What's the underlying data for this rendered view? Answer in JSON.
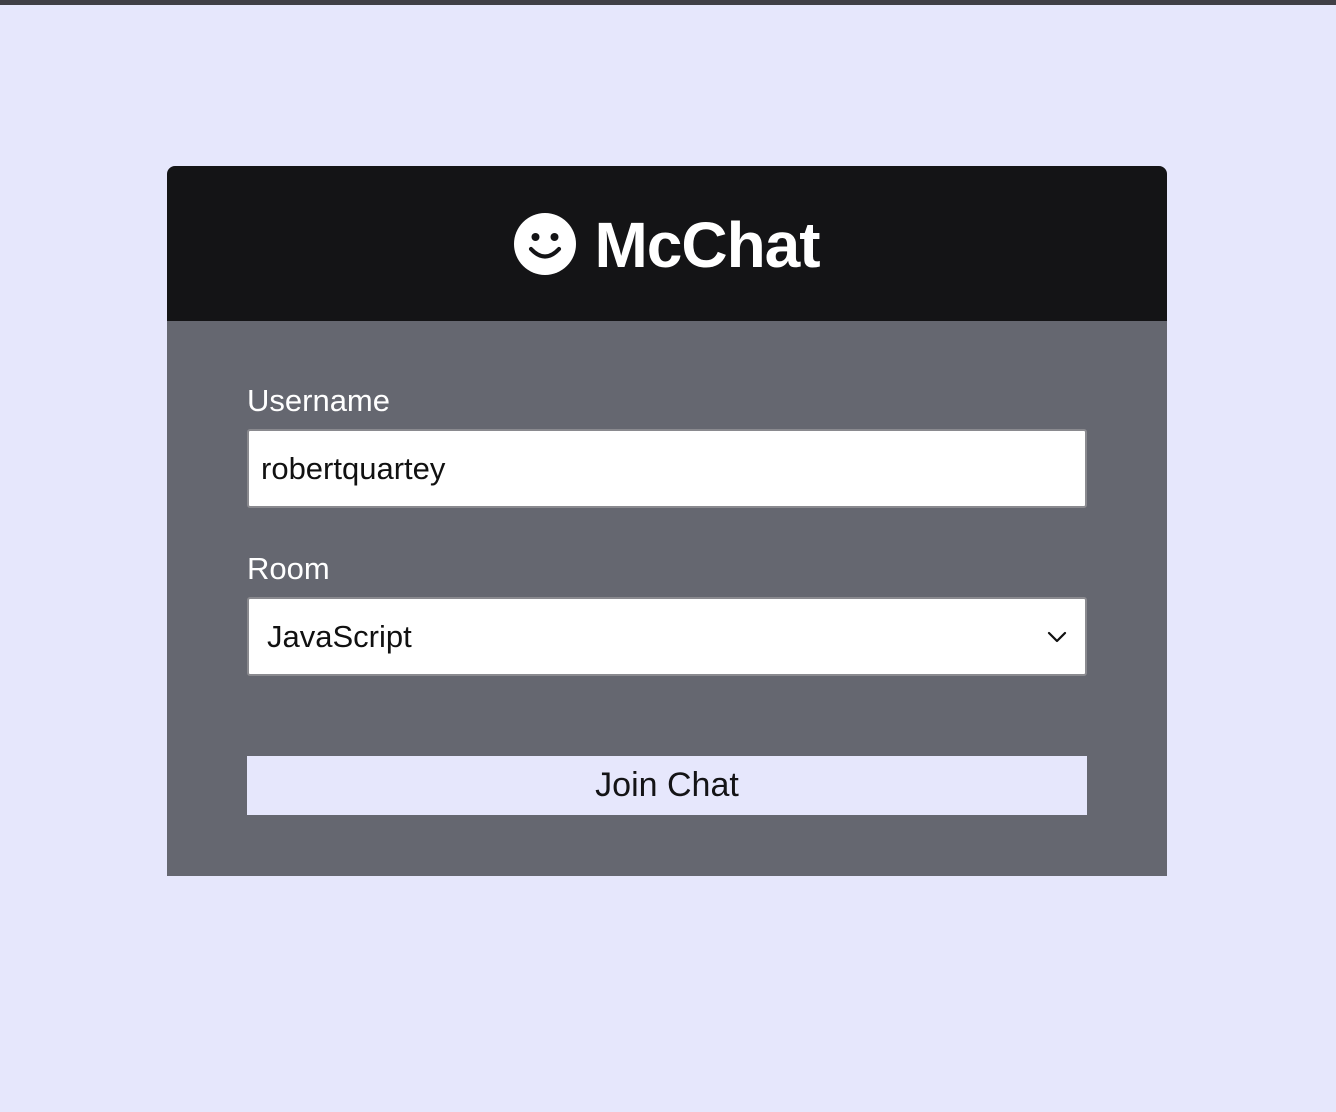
{
  "header": {
    "logo_icon": "smile-icon",
    "title": "McChat"
  },
  "form": {
    "username": {
      "label": "Username",
      "value": "robertquartey"
    },
    "room": {
      "label": "Room",
      "selected": "JavaScript"
    },
    "submit_label": "Join Chat"
  },
  "colors": {
    "page_background": "#e6e7fc",
    "header_background": "#141416",
    "form_background": "#656770",
    "button_background": "#e6e7fc"
  }
}
